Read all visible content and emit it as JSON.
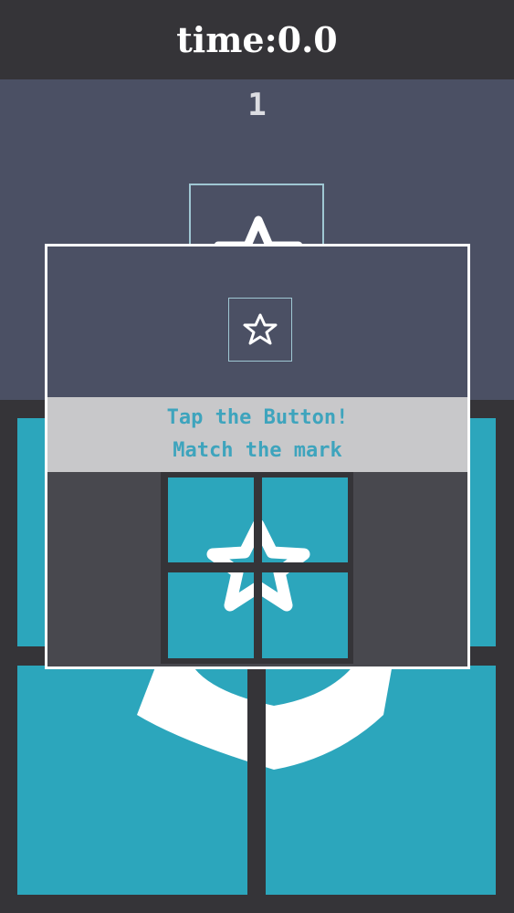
{
  "header": {
    "timer_text": "time:0.0"
  },
  "round": {
    "number": "1"
  },
  "tutorial": {
    "line1": "Tap the Button!",
    "line2": "Match the mark"
  },
  "target_mark": {
    "icon": "star-icon"
  },
  "board": {
    "rows": 2,
    "cols": 2,
    "tile_color": "#2ca6bc"
  },
  "colors": {
    "accent": "#2ca6bc",
    "panel": "#4b5064",
    "background": "#353438",
    "banner_text": "#3ea4bd",
    "banner_bg": "#c8c8ca"
  }
}
